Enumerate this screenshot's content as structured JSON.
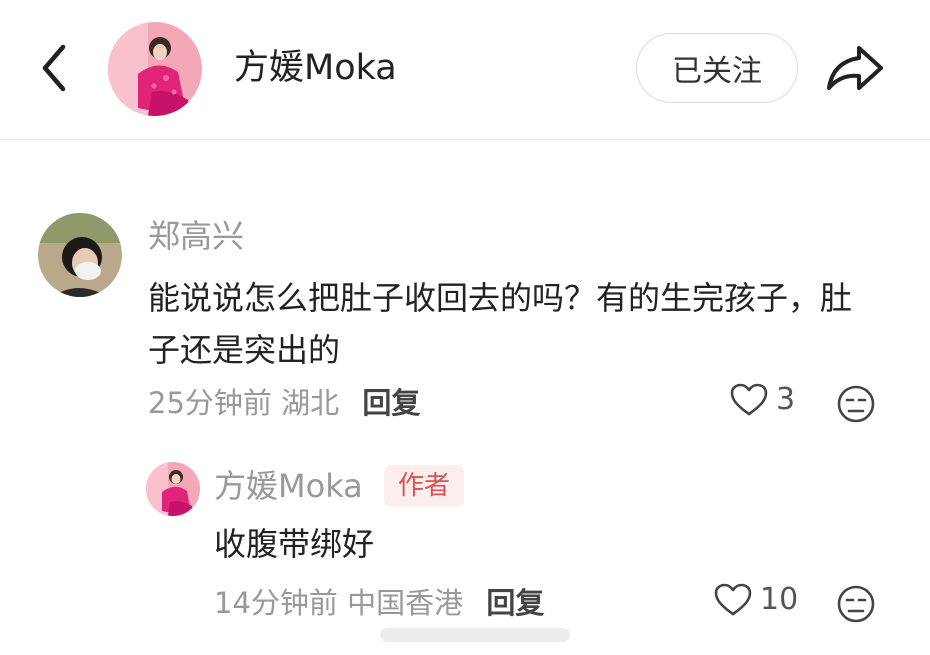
{
  "header": {
    "name": "方媛Moka",
    "follow_label": "已关注",
    "icons": {
      "back": "chevron-left-icon",
      "share": "share-arrow-icon"
    }
  },
  "comments": [
    {
      "user": "郑高兴",
      "text": "能说说怎么把肚子收回去的吗？有的生完孩子，肚子还是突出的",
      "time": "25分钟前",
      "location": "湖北",
      "reply_label": "回复",
      "likes": "3"
    }
  ],
  "replies": [
    {
      "user": "方媛Moka",
      "badge": "作者",
      "text": "收腹带绑好",
      "time": "14分钟前",
      "location": "中国香港",
      "reply_label": "回复",
      "likes": "10"
    }
  ],
  "colors": {
    "accent_badge_bg": "#fdeeee",
    "accent_badge_text": "#d9534f",
    "muted_text": "#999999",
    "divider": "#ececec"
  }
}
